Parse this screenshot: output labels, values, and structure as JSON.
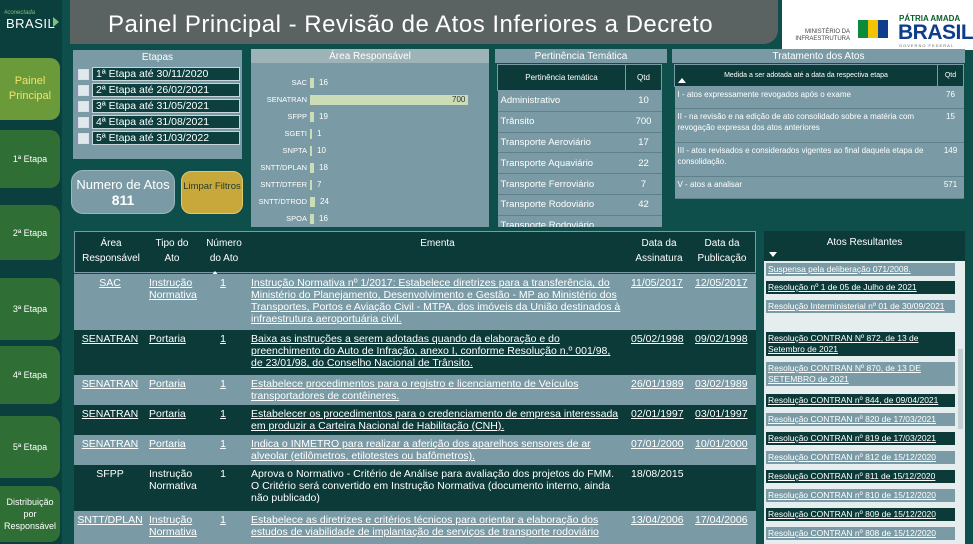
{
  "sidebar": {
    "logo_small": "#conectada",
    "logo_big": "BRASIL",
    "items": [
      {
        "label": "Painel Principal",
        "active": true
      },
      {
        "label": "1ª Etapa"
      },
      {
        "label": "2ª Etapa"
      },
      {
        "label": "3ª Etapa"
      },
      {
        "label": "4ª Etapa"
      },
      {
        "label": "5ª Etapa"
      },
      {
        "label": "Distribuição por Responsável"
      }
    ]
  },
  "header": {
    "title": "Painel Principal - Revisão de Atos Inferiores a Decreto",
    "ministerio": "MINISTÉRIO DA INFRAESTRUTURA",
    "patria": "PÁTRIA AMADA",
    "brasil": "BRASIL",
    "governo": "GOVERNO FEDERAL"
  },
  "etapas": {
    "title": "Etapas",
    "items": [
      "1ª Etapa até 30/11/2020",
      "2ª Etapa até 26/02/2021",
      "3ª Etapa até 31/05/2021",
      "4ª Etapa até 31/08/2021",
      "5ª Etapa até 31/03/2022"
    ]
  },
  "kpi": {
    "label": "Numero de Atos",
    "value": "811"
  },
  "limpar": {
    "label": "Limpar Filtros"
  },
  "area": {
    "title": "Área Responsável",
    "max": 700,
    "rows": [
      {
        "label": "SAC",
        "value": 16
      },
      {
        "label": "SENATRAN",
        "value": 700
      },
      {
        "label": "SFPP",
        "value": 19
      },
      {
        "label": "SGETI",
        "value": 1
      },
      {
        "label": "SNPTA",
        "value": 10
      },
      {
        "label": "SNTT/DPLAN",
        "value": 18
      },
      {
        "label": "SNTT/DTFER",
        "value": 7
      },
      {
        "label": "SNTT/DTROD",
        "value": 24
      },
      {
        "label": "SPOA",
        "value": 16
      }
    ]
  },
  "pertinencia": {
    "title": "Pertinência Temática",
    "col1": "Pertinência temática",
    "col2": "Qtd",
    "rows": [
      {
        "label": "Administrativo",
        "q": "10"
      },
      {
        "label": "Trânsito",
        "q": "700"
      },
      {
        "label": "Transporte Aeroviário",
        "q": "17"
      },
      {
        "label": "Transporte Aquaviário",
        "q": "22"
      },
      {
        "label": "Transporte Ferroviário",
        "q": "7"
      },
      {
        "label": "Transporte Rodoviário",
        "q": "42"
      },
      {
        "label": "Transporte Rodoviário",
        "q": ""
      }
    ]
  },
  "tratamento": {
    "title": "Tratamento dos Atos",
    "col1": "Medida a ser adotada até a data da respectiva etapa",
    "col2": "Qtd",
    "rows": [
      {
        "label": "I - atos expressamente revogados após o exame",
        "q": "76"
      },
      {
        "label": "II - na revisão e na edição de ato consolidado sobre a matéria com revogação expressa dos atos anteriores",
        "q": "15"
      },
      {
        "label": "III - atos revisados e considerados vigentes ao final daquela etapa de consolidação.",
        "q": "149"
      },
      {
        "label": "V - atos a analisar",
        "q": "571"
      }
    ]
  },
  "main": {
    "headers": {
      "area": "Área Responsável",
      "tipo": "Tipo do Ato",
      "numero": "Número do Ato",
      "ementa": "Ementa",
      "assinatura": "Data da Assinatura",
      "publicacao": "Data da Publicação"
    },
    "rows": [
      {
        "area": "SAC",
        "tipo": "Instrução Normativa",
        "num": "1",
        "ementa": "Instrução Normativa nº 1/2017: Estabelece diretrizes para a transferência, do Ministério do Planejamento, Desenvolvimento e Gestão - MP ao Ministério dos Transportes, Portos e Aviação Civil - MTPA, dos imóveis da União destinados à infraestrutura aeroportuária civil.",
        "ass": "11/05/2017",
        "pub": "12/05/2017"
      },
      {
        "area": "SENATRAN",
        "tipo": "Portaria",
        "num": "1",
        "ementa": "Baixa as instruções a serem adotadas quando da elaboração e do preenchimento do Auto de Infração, anexo I, conforme Resolução n.º 001/98, de 23/01/98, do Conselho Nacional de Trânsito.",
        "ass": "05/02/1998",
        "pub": "09/02/1998"
      },
      {
        "area": "SENATRAN",
        "tipo": "Portaria",
        "num": "1",
        "ementa": "Estabelece procedimentos para o registro e licenciamento de Veículos transportadores de contêineres.",
        "ass": "26/01/1989",
        "pub": "03/02/1989"
      },
      {
        "area": "SENATRAN",
        "tipo": "Portaria",
        "num": "1",
        "ementa": "Estabelecer os procedimentos para o credenciamento de empresa interessada em produzir a Carteira Nacional de Habilitação (CNH).",
        "ass": "02/01/1997",
        "pub": "03/01/1997"
      },
      {
        "area": "SENATRAN",
        "tipo": "Portaria",
        "num": "1",
        "ementa": "Indica o INMETRO para realizar a aferição dos aparelhos sensores de ar alveolar (etilômetros, etilotestes ou bafômetros).",
        "ass": "07/01/2000",
        "pub": "10/01/2000"
      },
      {
        "area": "SFPP",
        "tipo": "Instrução Normativa",
        "num": "1",
        "ementa": "Aprova o Normativo - Critério de Análise para avaliação dos projetos do FMM. O Critério será convertido em Instrução Normativa (documento interno, ainda não publicado)",
        "ass": "18/08/2015",
        "pub": ""
      },
      {
        "area": "SNTT/DPLAN",
        "tipo": "Instrução Normativa",
        "num": "1",
        "ementa": "Estabelece as diretrizes e critérios técnicos para orientar a elaboração dos estudos de viabilidade de implantação de serviços de transporte rodoviário",
        "ass": "13/04/2006",
        "pub": "17/04/2006"
      }
    ]
  },
  "atos": {
    "title": "Atos Resultantes",
    "items": [
      "Suspensa pela deliberação 071/2008.",
      "Resolução nº 1 de 05 de Julho de 2021",
      "Resolução Interministerial nº 01 de 30/09/2021",
      "Resolução CONTRAN Nº 872, de 13 de Setembro de 2021",
      "Resolução CONTRAN Nº 870, de 13 DE SETEMBRO de 2021",
      "Resolução CONTRAN nº 844, de 09/04/2021",
      "Resolução CONTRAN nº 820 de 17/03/2021",
      "Resolução CONTRAN nº 819 de 17/03/2021",
      "Resolução CONTRAN nº 812 de 15/12/2020",
      "Resolução CONTRAN nº 811 de 15/12/2020",
      "Resolução CONTRAN nº 810 de 15/12/2020",
      "Resolução CONTRAN nº 809 de 15/12/2020",
      "Resolução CONTRAN nº 808 de 15/12/2020"
    ]
  }
}
